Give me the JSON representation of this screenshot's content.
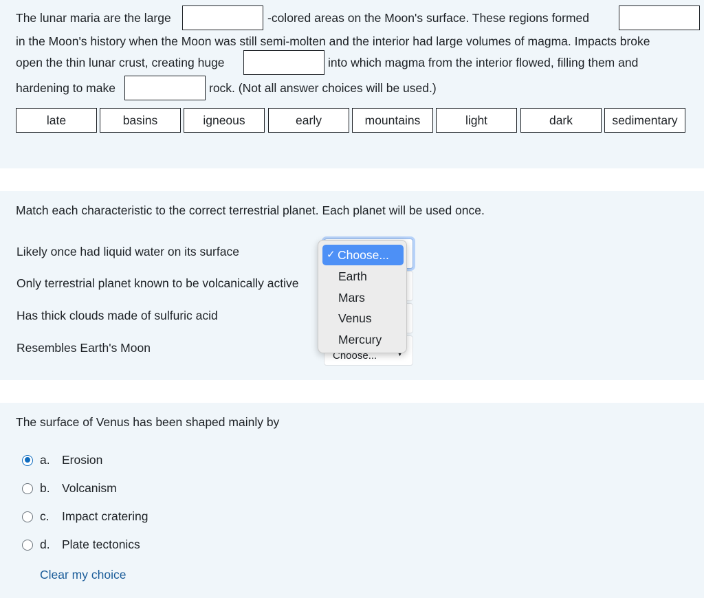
{
  "q1": {
    "line1": {
      "before": "The lunar maria are the large",
      "middle": "-colored areas on the Moon's surface.  These regions formed"
    },
    "line2": "in the Moon's history when the Moon was still semi-molten and the interior had large volumes of magma.  Impacts broke",
    "line3": {
      "before": "open the thin lunar crust, creating huge",
      "after": "into which magma from the interior flowed, filling them and"
    },
    "line4": {
      "before": "hardening to make",
      "after": "rock.  (Not all answer choices will be used.)"
    },
    "choices": [
      "late",
      "basins",
      "igneous",
      "early",
      "mountains",
      "light",
      "dark",
      "sedimentary"
    ]
  },
  "q2": {
    "prompt": "Match each characteristic to the correct terrestrial planet.  Each planet will be used once.",
    "stems": [
      "Likely once had liquid water on its surface",
      "Only terrestrial planet known to be volcanically active",
      "Has thick clouds made of sulfuric acid",
      "Resembles Earth's Moon"
    ],
    "select_value": "Choose...",
    "dropdown": {
      "selected": "Choose...",
      "options": [
        "Earth",
        "Mars",
        "Venus",
        "Mercury"
      ]
    }
  },
  "q3": {
    "prompt": "The surface of Venus has been shaped mainly by",
    "options": [
      {
        "letter": "a.",
        "text": "Erosion"
      },
      {
        "letter": "b.",
        "text": "Volcanism"
      },
      {
        "letter": "c.",
        "text": "Impact cratering"
      },
      {
        "letter": "d.",
        "text": "Plate tectonics"
      }
    ],
    "selected_index": 0,
    "clear_label": "Clear my choice"
  },
  "colors": {
    "panel_bg": "#f0f6fa",
    "accent": "#0f6cbf",
    "link": "#1a5c99",
    "dropdown_highlight": "#4d90f6"
  },
  "icons": {
    "check": "check-icon",
    "caret": "caret-down-icon"
  }
}
